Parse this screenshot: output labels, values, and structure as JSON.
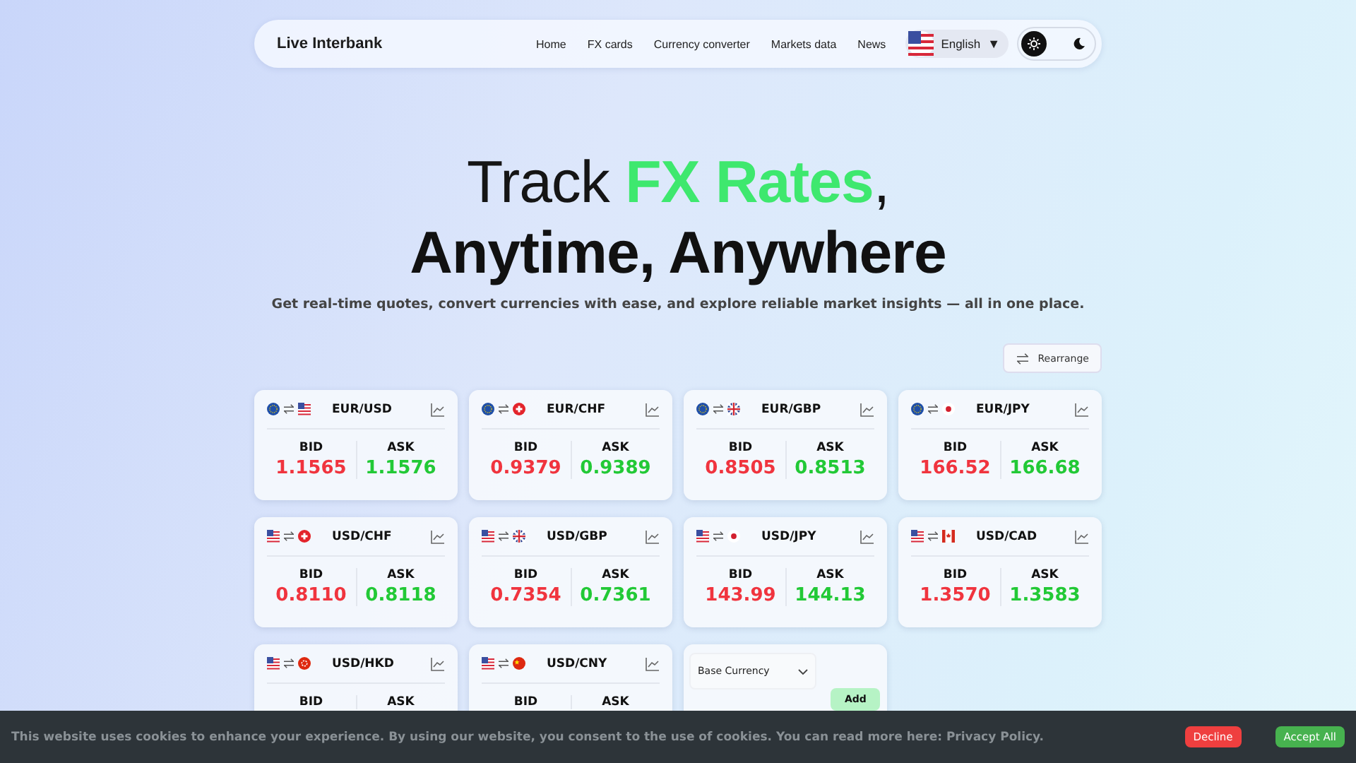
{
  "nav": {
    "brand": "Live Interbank",
    "links": [
      "Home",
      "FX cards",
      "Currency converter",
      "Markets data",
      "News"
    ],
    "language": {
      "label": "English",
      "caret": "▼"
    },
    "theme_toggle": [
      {
        "kind": "light",
        "selected": true
      },
      {
        "kind": "dark",
        "selected": false
      }
    ]
  },
  "hero": {
    "title_start": "Track ",
    "title_highlight": "FX Rates",
    "title_end": ",",
    "title_line2": "Anytime, Anywhere",
    "subtitle": "Get real-time quotes, convert currencies with ease, and explore reliable market insights — all in one place."
  },
  "rearrange_button": "Rearrange",
  "cards": [
    {
      "pair": "EUR/USD",
      "flags": [
        {
          "kind": "eu"
        },
        {
          "kind": "us"
        }
      ],
      "bid_label": "BID",
      "ask_label": "ASK",
      "bid": "1.1565",
      "ask": "1.1576"
    },
    {
      "pair": "EUR/CHF",
      "flags": [
        {
          "kind": "eu"
        },
        {
          "kind": "ch"
        }
      ],
      "bid_label": "BID",
      "ask_label": "ASK",
      "bid": "0.9379",
      "ask": "0.9389"
    },
    {
      "pair": "EUR/GBP",
      "flags": [
        {
          "kind": "eu"
        },
        {
          "kind": "gb"
        }
      ],
      "bid_label": "BID",
      "ask_label": "ASK",
      "bid": "0.8505",
      "ask": "0.8513"
    },
    {
      "pair": "EUR/JPY",
      "flags": [
        {
          "kind": "eu"
        },
        {
          "kind": "jp"
        }
      ],
      "bid_label": "BID",
      "ask_label": "ASK",
      "bid": "166.52",
      "ask": "166.68"
    },
    {
      "pair": "USD/CHF",
      "flags": [
        {
          "kind": "us"
        },
        {
          "kind": "ch"
        }
      ],
      "bid_label": "BID",
      "ask_label": "ASK",
      "bid": "0.8110",
      "ask": "0.8118"
    },
    {
      "pair": "USD/GBP",
      "flags": [
        {
          "kind": "us"
        },
        {
          "kind": "gb"
        }
      ],
      "bid_label": "BID",
      "ask_label": "ASK",
      "bid": "0.7354",
      "ask": "0.7361"
    },
    {
      "pair": "USD/JPY",
      "flags": [
        {
          "kind": "us"
        },
        {
          "kind": "jp"
        }
      ],
      "bid_label": "BID",
      "ask_label": "ASK",
      "bid": "143.99",
      "ask": "144.13"
    },
    {
      "pair": "USD/CAD",
      "flags": [
        {
          "kind": "us"
        },
        {
          "kind": "ca"
        }
      ],
      "bid_label": "BID",
      "ask_label": "ASK",
      "bid": "1.3570",
      "ask": "1.3583"
    },
    {
      "pair": "USD/HKD",
      "flags": [
        {
          "kind": "us"
        },
        {
          "kind": "hk"
        }
      ],
      "bid_label": "BID",
      "ask_label": "ASK"
    },
    {
      "pair": "USD/CNY",
      "flags": [
        {
          "kind": "us"
        },
        {
          "kind": "cn"
        }
      ],
      "bid_label": "BID",
      "ask_label": "ASK"
    }
  ],
  "add_card": {
    "select_value": "Base Currency",
    "add_button": "Add"
  },
  "cookie_bar": {
    "message": "This website uses cookies to enhance your experience. By using our website, you consent to the use of cookies. You can read more here: Privacy Policy.",
    "buttons": [
      {
        "label": "Decline",
        "kind": "decline"
      },
      {
        "label": "Accept All",
        "kind": "accept"
      }
    ]
  }
}
